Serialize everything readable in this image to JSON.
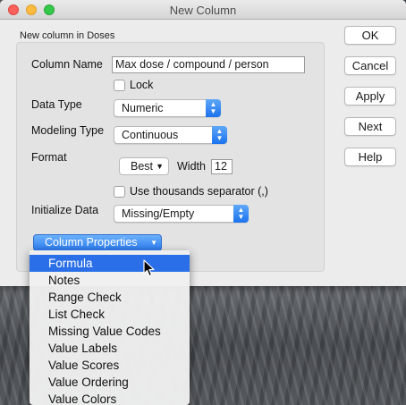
{
  "window": {
    "title": "New Column"
  },
  "group_label": "New column in Doses",
  "form": {
    "column_name_label": "Column Name",
    "column_name_value": "Max dose / compound / person",
    "lock_label": "Lock",
    "lock_checked": false,
    "data_type_label": "Data Type",
    "data_type_value": "Numeric",
    "modeling_type_label": "Modeling Type",
    "modeling_type_value": "Continuous",
    "format_label": "Format",
    "format_value": "Best",
    "width_label": "Width",
    "width_value": "12",
    "thousands_label": "Use thousands separator (,)",
    "thousands_checked": false,
    "initialize_label": "Initialize Data",
    "initialize_value": "Missing/Empty",
    "column_properties_label": "Column Properties"
  },
  "buttons": {
    "ok": "OK",
    "cancel": "Cancel",
    "apply": "Apply",
    "next": "Next",
    "help": "Help"
  },
  "menu": {
    "selected": "Formula",
    "items": [
      "Formula",
      "Notes",
      "Range Check",
      "List Check",
      "Missing Value Codes",
      "Value Labels",
      "Value Scores",
      "Value Ordering",
      "Value Colors"
    ]
  },
  "colors": {
    "accent": "#2a6fe8",
    "popup_arrow": "#1b72ee"
  }
}
